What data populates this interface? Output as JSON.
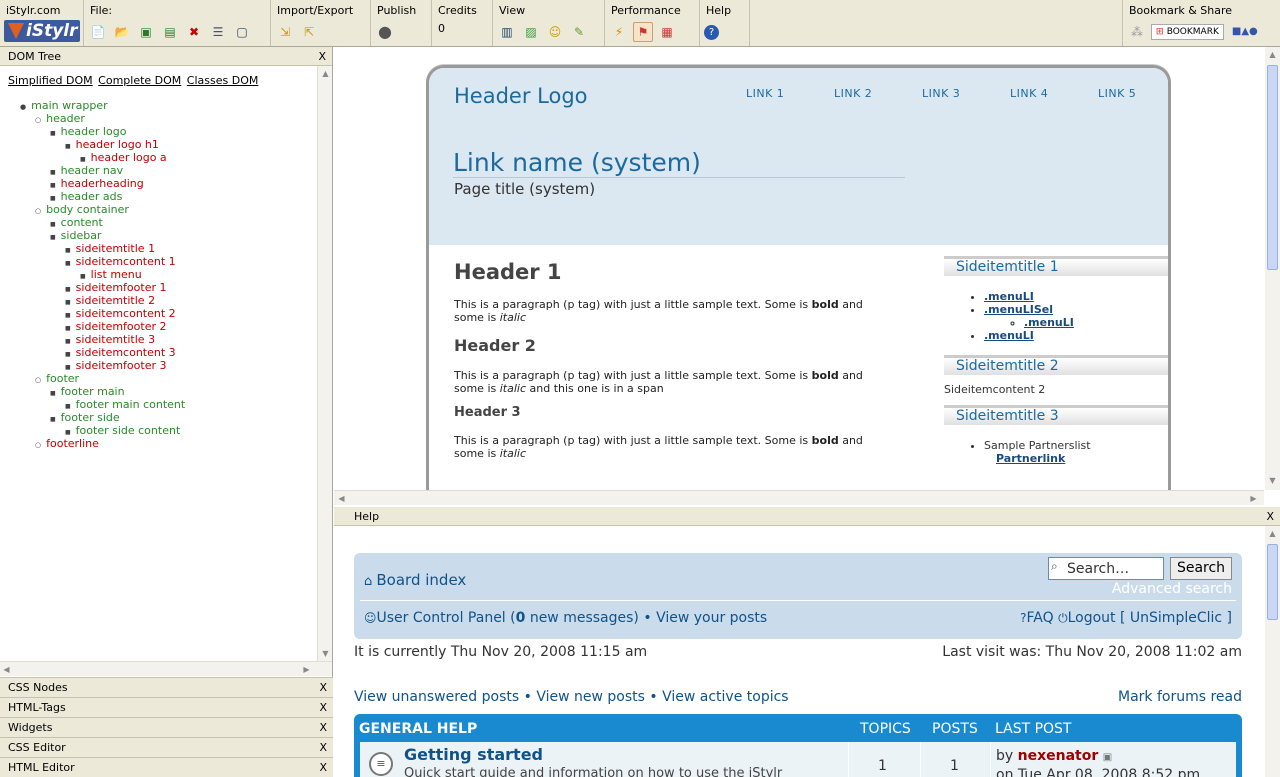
{
  "toolbar": {
    "site": "iStylr.com",
    "logo": "iStylr",
    "file": "File:",
    "import_export": "Import/Export",
    "publish": "Publish",
    "credits": "Credits",
    "credits_value": "0",
    "view": "View",
    "performance": "Performance",
    "help": "Help",
    "bookmark_share": "Bookmark & Share",
    "bookmark_btn": "BOOKMARK"
  },
  "left": {
    "title": "DOM Tree",
    "tabs": [
      "Simplified DOM",
      "Complete DOM",
      "Classes DOM"
    ],
    "tree": [
      {
        "label": "main wrapper",
        "c": "g",
        "lvl": 1
      },
      {
        "label": "header",
        "c": "g",
        "lvl": 2
      },
      {
        "label": "header logo",
        "c": "g",
        "lvl": 3
      },
      {
        "label": "header logo h1",
        "c": "r",
        "lvl": 4
      },
      {
        "label": "header logo a",
        "c": "r",
        "lvl": 5
      },
      {
        "label": "header nav",
        "c": "g",
        "lvl": 3
      },
      {
        "label": "headerheading",
        "c": "r",
        "lvl": 3
      },
      {
        "label": "header ads",
        "c": "g",
        "lvl": 3
      },
      {
        "label": "body container",
        "c": "g",
        "lvl": 2
      },
      {
        "label": "content",
        "c": "g",
        "lvl": 3
      },
      {
        "label": "sidebar",
        "c": "g",
        "lvl": 3
      },
      {
        "label": "sideitemtitle 1",
        "c": "r",
        "lvl": 4
      },
      {
        "label": "sideitemcontent 1",
        "c": "r",
        "lvl": 4
      },
      {
        "label": "list menu",
        "c": "r",
        "lvl": 5
      },
      {
        "label": "sideitemfooter 1",
        "c": "r",
        "lvl": 4
      },
      {
        "label": "sideitemtitle 2",
        "c": "r",
        "lvl": 4
      },
      {
        "label": "sideitemcontent 2",
        "c": "r",
        "lvl": 4
      },
      {
        "label": "sideitemfooter 2",
        "c": "r",
        "lvl": 4
      },
      {
        "label": "sideitemtitle 3",
        "c": "r",
        "lvl": 4
      },
      {
        "label": "sideitemcontent 3",
        "c": "r",
        "lvl": 4
      },
      {
        "label": "sideitemfooter 3",
        "c": "r",
        "lvl": 4
      },
      {
        "label": "footer",
        "c": "g",
        "lvl": 2
      },
      {
        "label": "footer main",
        "c": "g",
        "lvl": 3
      },
      {
        "label": "footer main content",
        "c": "g",
        "lvl": 4
      },
      {
        "label": "footer side",
        "c": "g",
        "lvl": 3
      },
      {
        "label": "footer side content",
        "c": "g",
        "lvl": 4
      },
      {
        "label": "footerline",
        "c": "r",
        "lvl": 2
      }
    ],
    "panels": [
      "CSS Nodes",
      "HTML-Tags",
      "Widgets",
      "CSS Editor",
      "HTML Editor"
    ],
    "close": "X"
  },
  "preview": {
    "logo": "Header Logo",
    "links": [
      "LINK 1",
      "LINK 2",
      "LINK 3",
      "LINK 4",
      "LINK 5"
    ],
    "link_name": "Link name (system)",
    "page_title": "Page title (system)",
    "h1": "Header 1",
    "h2": "Header 2",
    "h3": "Header 3",
    "p_a": "This is a paragraph (p tag) with just a little sample text. Some is ",
    "bold": "bold",
    "p_b": " and some is ",
    "italic": "italic",
    "p_span": " and this one is in a span",
    "side1": "Sideitemtitle 1",
    "menu": [
      ".menuLI",
      ".menuLISel",
      ".menuLI",
      ".menuLI"
    ],
    "side2": "Sideitemtitle 2",
    "side2content": "Sideitemcontent 2",
    "side3": "Sideitemtitle 3",
    "partners": "Sample Partnerslist",
    "partnerlink": "Partnerlink"
  },
  "help": {
    "title": "Help",
    "board_index": "Board index",
    "search_placeholder": "Search…",
    "search_btn": "Search",
    "advanced": "Advanced search",
    "ucp_a": "User Control Panel (",
    "ucp_n": "0",
    "ucp_b": " new messages)",
    "view_posts": "View your posts",
    "faq": "FAQ",
    "logout": "Logout [ UnSimpleClic ]",
    "currently": "It is currently Thu Nov 20, 2008 11:15 am",
    "last_visit": "Last visit was: Thu Nov 20, 2008 11:02 am",
    "unanswered": "View unanswered posts",
    "new_posts": "View new posts",
    "active": "View active topics",
    "mark_read": "Mark forums read",
    "col_general": "GENERAL HELP",
    "col_topics": "TOPICS",
    "col_posts": "POSTS",
    "col_last": "LAST POST",
    "forum_name": "Getting started",
    "forum_desc": "Quick start guide and information on how to use the iStylr",
    "topics": "1",
    "posts": "1",
    "by": "by ",
    "last_author": "nexenator",
    "last_date": "on Tue Apr 08, 2008 8:52 pm"
  }
}
